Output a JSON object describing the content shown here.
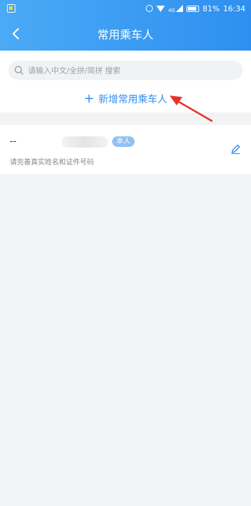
{
  "statusbar": {
    "network": "4G",
    "battery": "81%",
    "time": "16:34"
  },
  "nav": {
    "title": "常用乘车人",
    "back_icon": "chevron-left-icon"
  },
  "search": {
    "placeholder": "请输入中文/全拼/简拼 搜索",
    "value": ""
  },
  "add_passenger": {
    "label": "新增常用乘车人",
    "icon": "plus-icon"
  },
  "passengers": [
    {
      "name": "--",
      "badge": "本人",
      "hint": "请完善真实姓名和证件号码"
    }
  ],
  "colors": {
    "header_start": "#4aaaf6",
    "header_end": "#2e8ff0",
    "accent": "#2f8ef0",
    "badge": "#8fc2f2",
    "arrow": "#e8312b",
    "background": "#f2f3f5"
  }
}
